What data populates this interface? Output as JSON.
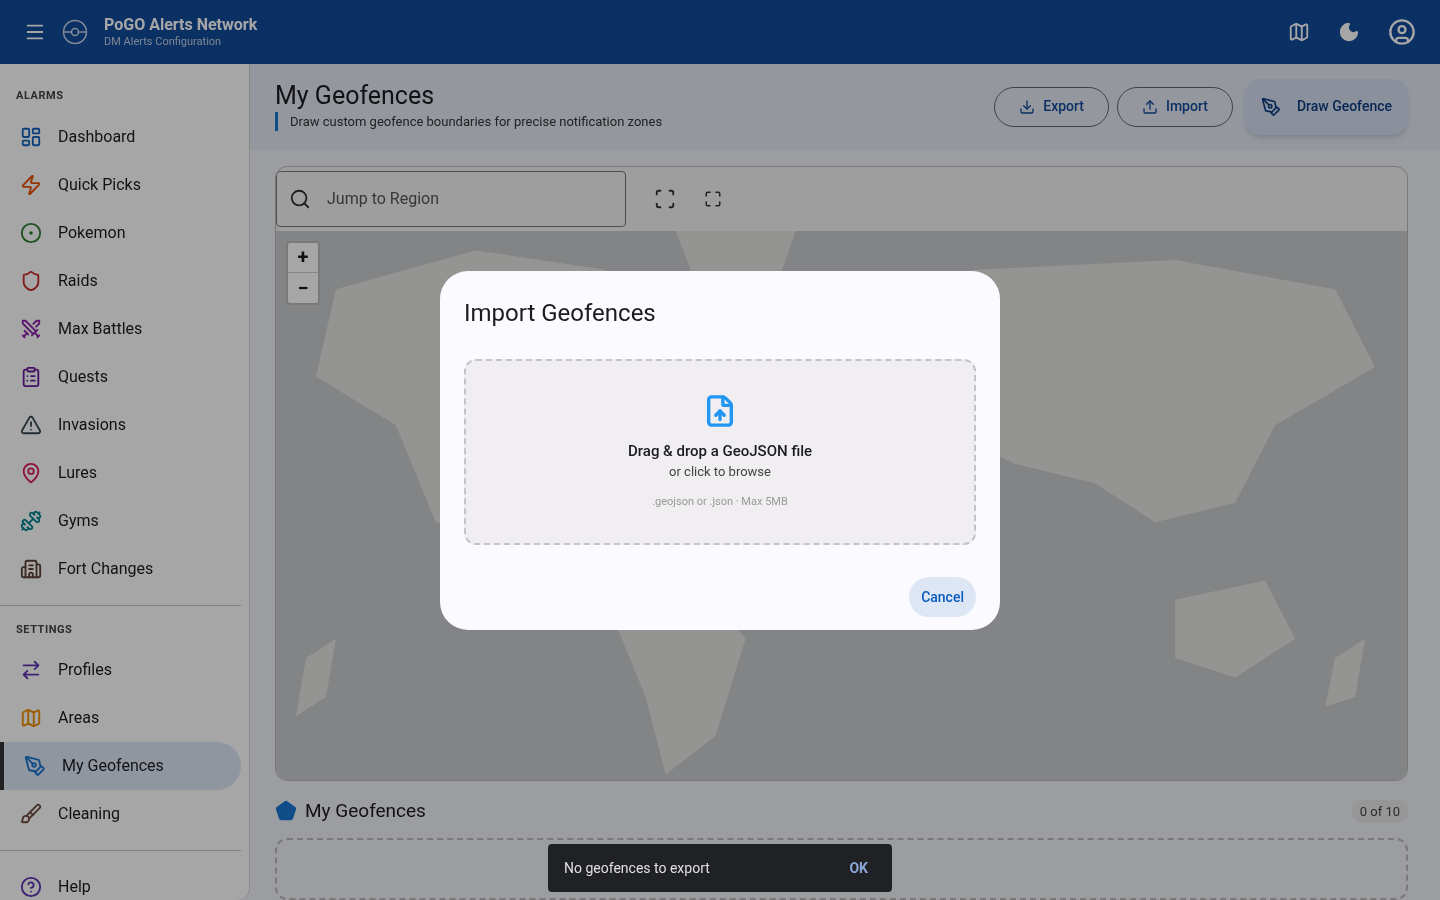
{
  "app_bar": {
    "title": "PoGO Alerts Network",
    "subtitle": "DM Alerts Configuration"
  },
  "sidebar": {
    "sections": [
      {
        "heading": "ALARMS",
        "items": [
          {
            "label": "Dashboard",
            "selected": false
          },
          {
            "label": "Quick Picks",
            "selected": false
          },
          {
            "label": "Pokemon",
            "selected": false
          },
          {
            "label": "Raids",
            "selected": false
          },
          {
            "label": "Max Battles",
            "selected": false
          },
          {
            "label": "Quests",
            "selected": false
          },
          {
            "label": "Invasions",
            "selected": false
          },
          {
            "label": "Lures",
            "selected": false
          },
          {
            "label": "Gyms",
            "selected": false
          },
          {
            "label": "Fort Changes",
            "selected": false
          }
        ]
      },
      {
        "heading": "SETTINGS",
        "items": [
          {
            "label": "Profiles",
            "selected": false
          },
          {
            "label": "Areas",
            "selected": false
          },
          {
            "label": "My Geofences",
            "selected": true
          },
          {
            "label": "Cleaning",
            "selected": false
          }
        ]
      },
      {
        "items": [
          {
            "label": "Help",
            "selected": false
          }
        ]
      }
    ]
  },
  "page": {
    "title": "My Geofences",
    "subtitle": "Draw custom geofence boundaries for precise notification zones",
    "buttons": [
      "Export",
      "Import"
    ],
    "primary_button": "Draw Geofence"
  },
  "map": {
    "search": {
      "placeholder": "Jump to Region"
    },
    "zoom_in": "+",
    "zoom_out": "−",
    "kind": "picture"
  },
  "list": {
    "title": "My Geofences",
    "count": "0 of 10"
  },
  "dialog": {
    "title": "Import Geofences",
    "drop_title": "Drag & drop a GeoJSON file",
    "drop_subtitle": "or click to browse",
    "drop_hint": ".geojson or .json · Max 5MB",
    "cancel": "Cancel"
  },
  "snackbar": {
    "message": "No geofences to export",
    "action": "OK"
  }
}
